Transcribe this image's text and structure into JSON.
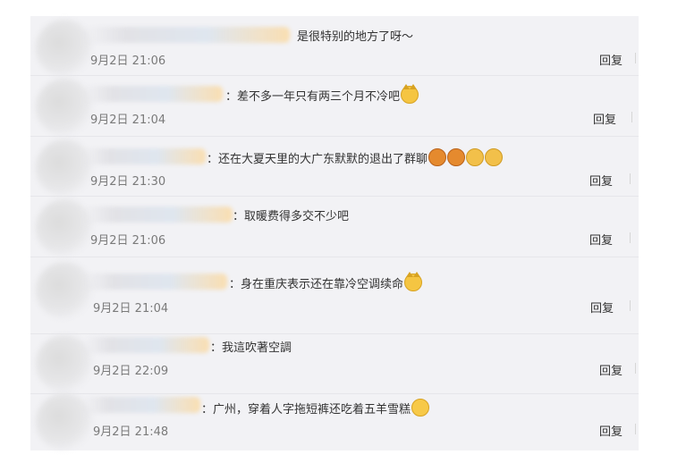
{
  "comments": [
    {
      "text": "是很特别的地方了呀～",
      "time": "9月2日 21:06",
      "reply": "回复",
      "emojis": []
    },
    {
      "text": "：差不多一年只有两三个月不冷吧",
      "time": "9月2日 21:04",
      "reply": "回复",
      "emojis": [
        "cat-face-icon"
      ]
    },
    {
      "text": "：还在大夏天里的大广东默默的退出了群聊",
      "time": "9月2日 21:30",
      "reply": "回复",
      "emojis": [
        "crying-face-icon",
        "crying-face-icon",
        "doge-face-icon",
        "doge-face-icon"
      ]
    },
    {
      "text": "：取暖费得多交不少吧",
      "time": "9月2日 21:06",
      "reply": "回复",
      "emojis": []
    },
    {
      "text": "：身在重庆表示还在靠冷空调续命",
      "time": "9月2日 21:04",
      "reply": "回复",
      "emojis": [
        "cat-face-icon"
      ]
    },
    {
      "text": "：我這吹著空調",
      "time": "9月2日 22:09",
      "reply": "回复",
      "emojis": []
    },
    {
      "text": "：广州，穿着人字拖短裤还吃着五羊雪糕",
      "time": "9月2日 21:48",
      "reply": "回复",
      "emojis": [
        "laughing-tears-icon"
      ]
    }
  ]
}
